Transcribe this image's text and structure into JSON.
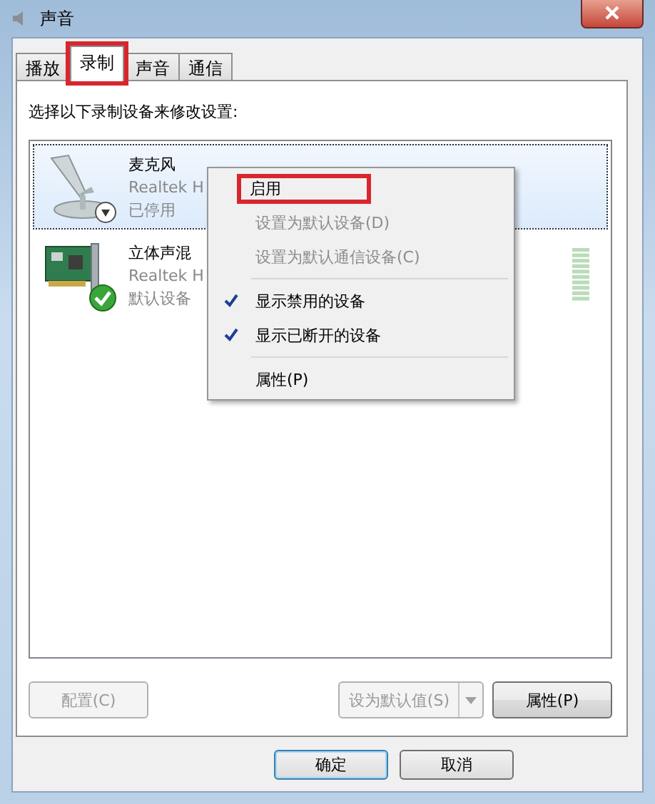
{
  "window": {
    "title": "声音"
  },
  "tabs": [
    {
      "label": "播放",
      "selected": false,
      "highlighted": false
    },
    {
      "label": "录制",
      "selected": true,
      "highlighted": true
    },
    {
      "label": "声音",
      "selected": false,
      "highlighted": false
    },
    {
      "label": "通信",
      "selected": false,
      "highlighted": false
    }
  ],
  "instruction": "选择以下录制设备来修改设置:",
  "devices": [
    {
      "kind": "microphone",
      "name": "麦克风",
      "driver": "Realtek H",
      "status": "已停用",
      "selected": true,
      "disabled": true,
      "default": false
    },
    {
      "kind": "sound-card",
      "name": "立体声混",
      "driver": "Realtek H",
      "status": "默认设备",
      "selected": false,
      "disabled": false,
      "default": true
    }
  ],
  "context_menu": {
    "items": [
      {
        "kind": "item",
        "label": "启用",
        "disabled": false,
        "checked": false,
        "highlighted": true
      },
      {
        "kind": "item",
        "label": "设置为默认设备(D)",
        "disabled": true,
        "checked": false,
        "highlighted": false
      },
      {
        "kind": "item",
        "label": "设置为默认通信设备(C)",
        "disabled": true,
        "checked": false,
        "highlighted": false
      },
      {
        "kind": "separator"
      },
      {
        "kind": "item",
        "label": "显示禁用的设备",
        "disabled": false,
        "checked": true,
        "highlighted": false
      },
      {
        "kind": "item",
        "label": "显示已断开的设备",
        "disabled": false,
        "checked": true,
        "highlighted": false
      },
      {
        "kind": "separator"
      },
      {
        "kind": "item",
        "label": "属性(P)",
        "disabled": false,
        "checked": false,
        "highlighted": false
      }
    ]
  },
  "panel_buttons": [
    {
      "kind": "button",
      "label": "配置(C)",
      "disabled": true
    },
    {
      "kind": "split",
      "label": "设为默认值(S)",
      "disabled": true
    },
    {
      "kind": "button",
      "label": "属性(P)",
      "disabled": false
    }
  ],
  "dialog_buttons": [
    {
      "label": "确定",
      "default": true
    },
    {
      "label": "取消",
      "default": false
    }
  ]
}
